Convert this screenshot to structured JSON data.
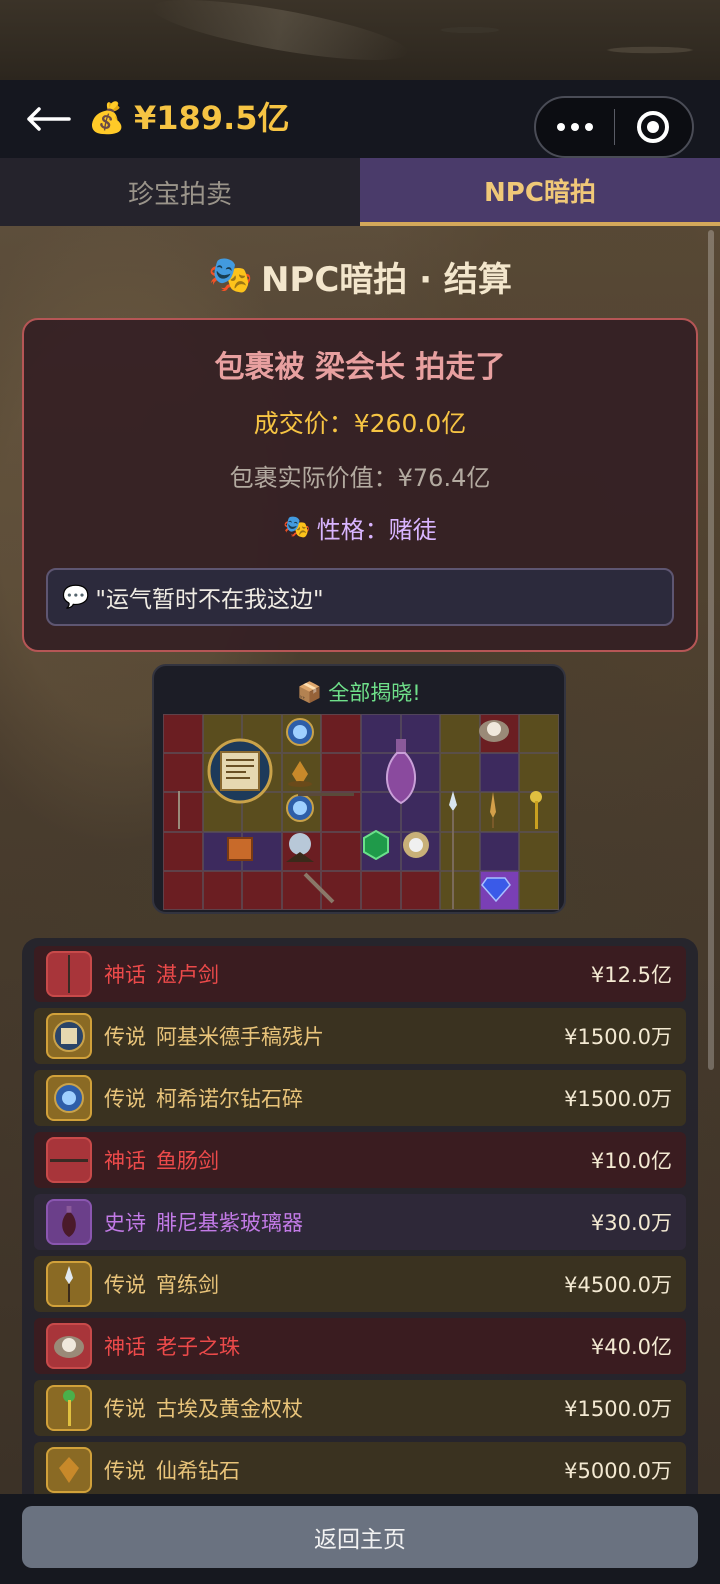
{
  "header": {
    "coin_icon": "money-bag-icon",
    "balance": "¥189.5亿"
  },
  "tabs": [
    {
      "label": "珍宝拍卖",
      "active": false
    },
    {
      "label": "NPC暗拍",
      "active": true
    }
  ],
  "section": {
    "title": "NPC暗拍 · 结算"
  },
  "result": {
    "winner_text": "包裹被 梁会长 拍走了",
    "deal_price": "成交价：¥260.0亿",
    "actual_value": "包裹实际价值：¥76.4亿",
    "personality": "性格：赌徒",
    "quote": "\"运气暂时不在我这边\""
  },
  "reveal": {
    "title": "全部揭晓!"
  },
  "items": [
    {
      "rarity": "神话",
      "name": "湛卢剑",
      "price": "¥12.5亿",
      "tier": "red",
      "icon": "sword-icon"
    },
    {
      "rarity": "传说",
      "name": "阿基米德手稿残片",
      "price": "¥1500.0万",
      "tier": "gold",
      "icon": "scroll-icon"
    },
    {
      "rarity": "传说",
      "name": "柯希诺尔钻石碎",
      "price": "¥1500.0万",
      "tier": "gold",
      "icon": "blue-orb-icon"
    },
    {
      "rarity": "神话",
      "name": "鱼肠剑",
      "price": "¥10.0亿",
      "tier": "red",
      "icon": "dagger-icon"
    },
    {
      "rarity": "史诗",
      "name": "腓尼基紫玻璃器",
      "price": "¥30.0万",
      "tier": "purple",
      "icon": "glass-vase-icon"
    },
    {
      "rarity": "传说",
      "name": "宵练剑",
      "price": "¥4500.0万",
      "tier": "gold",
      "icon": "spear-icon"
    },
    {
      "rarity": "神话",
      "name": "老子之珠",
      "price": "¥40.0亿",
      "tier": "red",
      "icon": "pearl-icon"
    },
    {
      "rarity": "传说",
      "name": "古埃及黄金权杖",
      "price": "¥1500.0万",
      "tier": "gold",
      "icon": "scepter-icon"
    },
    {
      "rarity": "传说",
      "name": "仙希钻石",
      "price": "¥5000.0万",
      "tier": "gold",
      "icon": "diamond-icon"
    }
  ],
  "footer": {
    "home_label": "返回主页"
  },
  "colors": {
    "gold": "#f6c443",
    "mythic_red": "#ec4a4a",
    "legend_gold": "#e9c47a",
    "epic_purple": "#c27ae6",
    "reveal_green": "#6fe08a"
  }
}
